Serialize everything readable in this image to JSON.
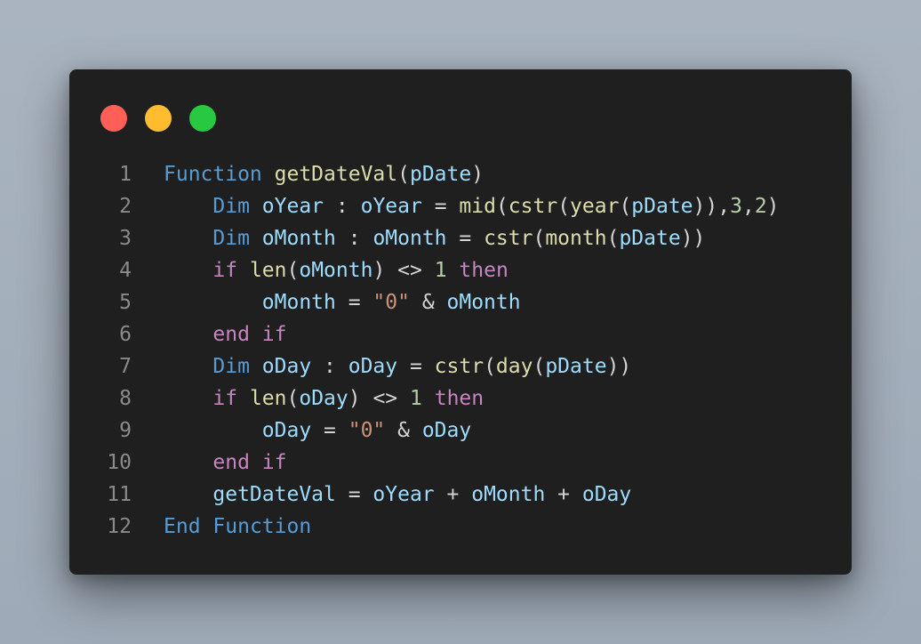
{
  "window": {
    "traffic_lights": [
      {
        "name": "close",
        "color": "#ff5f57"
      },
      {
        "name": "minimize",
        "color": "#febc2e"
      },
      {
        "name": "maximize",
        "color": "#28c840"
      }
    ]
  },
  "theme": {
    "background": "#1f1f1f",
    "keyword": "#569cd6",
    "control": "#c586c0",
    "function": "#dcdcaa",
    "variable": "#9cdcfe",
    "number": "#b5cea8",
    "string": "#ce9178",
    "line_number": "#8a8a8a"
  },
  "code": {
    "lines": [
      {
        "n": "1",
        "tokens": [
          [
            "kw",
            "Function"
          ],
          [
            "op",
            " "
          ],
          [
            "fn",
            "getDateVal"
          ],
          [
            "op",
            "("
          ],
          [
            "var",
            "pDate"
          ],
          [
            "op",
            ")"
          ]
        ]
      },
      {
        "n": "2",
        "tokens": [
          [
            "op",
            "    "
          ],
          [
            "kw",
            "Dim"
          ],
          [
            "op",
            " "
          ],
          [
            "var",
            "oYear"
          ],
          [
            "op",
            " : "
          ],
          [
            "var",
            "oYear"
          ],
          [
            "op",
            " = "
          ],
          [
            "fn",
            "mid"
          ],
          [
            "op",
            "("
          ],
          [
            "fn",
            "cstr"
          ],
          [
            "op",
            "("
          ],
          [
            "fn",
            "year"
          ],
          [
            "op",
            "("
          ],
          [
            "var",
            "pDate"
          ],
          [
            "op",
            ")),"
          ],
          [
            "num",
            "3"
          ],
          [
            "op",
            ","
          ],
          [
            "num",
            "2"
          ],
          [
            "op",
            ")"
          ]
        ]
      },
      {
        "n": "3",
        "tokens": [
          [
            "op",
            "    "
          ],
          [
            "kw",
            "Dim"
          ],
          [
            "op",
            " "
          ],
          [
            "var",
            "oMonth"
          ],
          [
            "op",
            " : "
          ],
          [
            "var",
            "oMonth"
          ],
          [
            "op",
            " = "
          ],
          [
            "fn",
            "cstr"
          ],
          [
            "op",
            "("
          ],
          [
            "fn",
            "month"
          ],
          [
            "op",
            "("
          ],
          [
            "var",
            "pDate"
          ],
          [
            "op",
            "))"
          ]
        ]
      },
      {
        "n": "4",
        "tokens": [
          [
            "op",
            "    "
          ],
          [
            "ctl",
            "if"
          ],
          [
            "op",
            " "
          ],
          [
            "fn",
            "len"
          ],
          [
            "op",
            "("
          ],
          [
            "var",
            "oMonth"
          ],
          [
            "op",
            ") <> "
          ],
          [
            "num",
            "1"
          ],
          [
            "op",
            " "
          ],
          [
            "ctl",
            "then"
          ]
        ]
      },
      {
        "n": "5",
        "tokens": [
          [
            "op",
            "        "
          ],
          [
            "var",
            "oMonth"
          ],
          [
            "op",
            " = "
          ],
          [
            "str",
            "\"0\""
          ],
          [
            "op",
            " & "
          ],
          [
            "var",
            "oMonth"
          ]
        ]
      },
      {
        "n": "6",
        "tokens": [
          [
            "op",
            "    "
          ],
          [
            "ctl",
            "end"
          ],
          [
            "op",
            " "
          ],
          [
            "ctl",
            "if"
          ]
        ]
      },
      {
        "n": "7",
        "tokens": [
          [
            "op",
            "    "
          ],
          [
            "kw",
            "Dim"
          ],
          [
            "op",
            " "
          ],
          [
            "var",
            "oDay"
          ],
          [
            "op",
            " : "
          ],
          [
            "var",
            "oDay"
          ],
          [
            "op",
            " = "
          ],
          [
            "fn",
            "cstr"
          ],
          [
            "op",
            "("
          ],
          [
            "fn",
            "day"
          ],
          [
            "op",
            "("
          ],
          [
            "var",
            "pDate"
          ],
          [
            "op",
            "))"
          ]
        ]
      },
      {
        "n": "8",
        "tokens": [
          [
            "op",
            "    "
          ],
          [
            "ctl",
            "if"
          ],
          [
            "op",
            " "
          ],
          [
            "fn",
            "len"
          ],
          [
            "op",
            "("
          ],
          [
            "var",
            "oDay"
          ],
          [
            "op",
            ") <> "
          ],
          [
            "num",
            "1"
          ],
          [
            "op",
            " "
          ],
          [
            "ctl",
            "then"
          ]
        ]
      },
      {
        "n": "9",
        "tokens": [
          [
            "op",
            "        "
          ],
          [
            "var",
            "oDay"
          ],
          [
            "op",
            " = "
          ],
          [
            "str",
            "\"0\""
          ],
          [
            "op",
            " & "
          ],
          [
            "var",
            "oDay"
          ]
        ]
      },
      {
        "n": "10",
        "tokens": [
          [
            "op",
            "    "
          ],
          [
            "ctl",
            "end"
          ],
          [
            "op",
            " "
          ],
          [
            "ctl",
            "if"
          ]
        ]
      },
      {
        "n": "11",
        "tokens": [
          [
            "op",
            "    "
          ],
          [
            "var",
            "getDateVal"
          ],
          [
            "op",
            " = "
          ],
          [
            "var",
            "oYear"
          ],
          [
            "op",
            " + "
          ],
          [
            "var",
            "oMonth"
          ],
          [
            "op",
            " + "
          ],
          [
            "var",
            "oDay"
          ]
        ]
      },
      {
        "n": "12",
        "tokens": [
          [
            "kw",
            "End"
          ],
          [
            "op",
            " "
          ],
          [
            "kw",
            "Function"
          ]
        ]
      }
    ]
  }
}
